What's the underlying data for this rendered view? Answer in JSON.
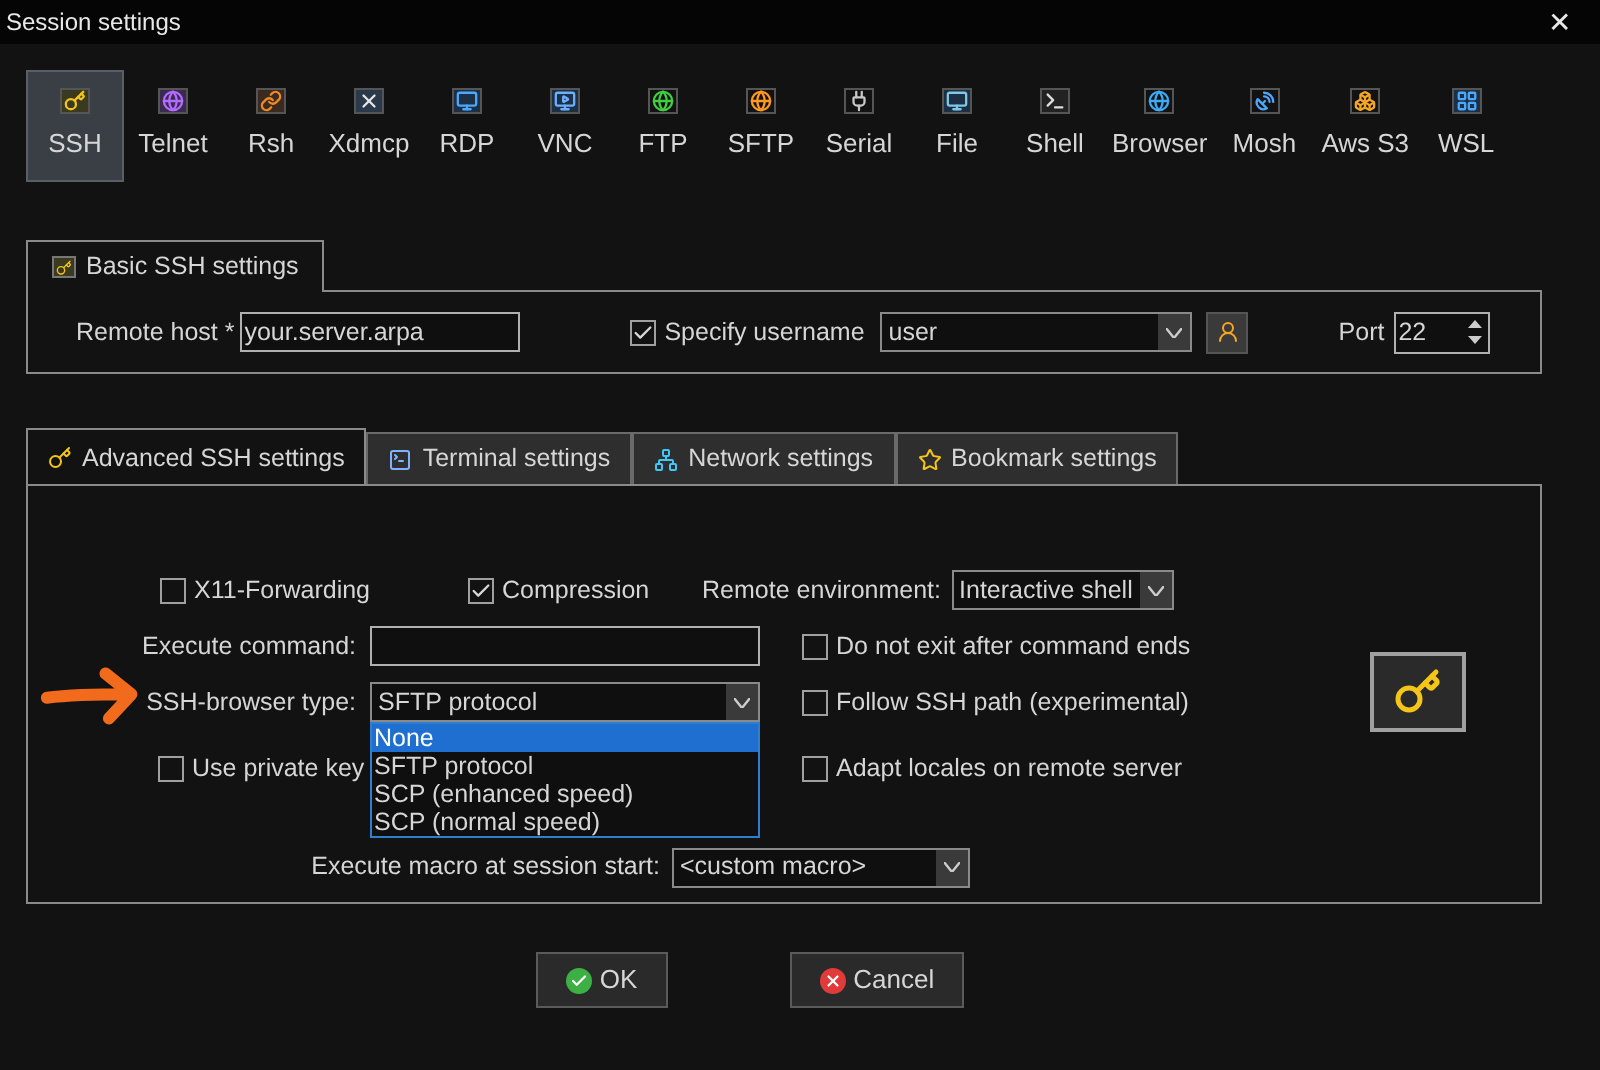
{
  "window": {
    "title": "Session settings",
    "close": "✕"
  },
  "session_types": [
    {
      "label": "SSH",
      "selected": true
    },
    {
      "label": "Telnet",
      "selected": false
    },
    {
      "label": "Rsh",
      "selected": false
    },
    {
      "label": "Xdmcp",
      "selected": false
    },
    {
      "label": "RDP",
      "selected": false
    },
    {
      "label": "VNC",
      "selected": false
    },
    {
      "label": "FTP",
      "selected": false
    },
    {
      "label": "SFTP",
      "selected": false
    },
    {
      "label": "Serial",
      "selected": false
    },
    {
      "label": "File",
      "selected": false
    },
    {
      "label": "Shell",
      "selected": false
    },
    {
      "label": "Browser",
      "selected": false
    },
    {
      "label": "Mosh",
      "selected": false
    },
    {
      "label": "Aws S3",
      "selected": false
    },
    {
      "label": "WSL",
      "selected": false
    }
  ],
  "basic": {
    "tab": "Basic SSH settings",
    "remote_host_label": "Remote host *",
    "remote_host": "your.server.arpa",
    "specify_username": {
      "label": "Specify username",
      "checked": true
    },
    "username": "user",
    "port_label": "Port",
    "port": "22"
  },
  "advanced_tabs": [
    {
      "label": "Advanced SSH settings",
      "selected": true
    },
    {
      "label": "Terminal settings",
      "selected": false
    },
    {
      "label": "Network settings",
      "selected": false
    },
    {
      "label": "Bookmark settings",
      "selected": false
    }
  ],
  "advanced": {
    "x11_forwarding": {
      "label": "X11-Forwarding",
      "checked": false
    },
    "compression": {
      "label": "Compression",
      "checked": true
    },
    "remote_environment_label": "Remote environment:",
    "remote_environment": "Interactive shell",
    "execute_command_label": "Execute command:",
    "do_not_exit": {
      "label": "Do not exit after command ends",
      "checked": false
    },
    "ssh_browser_label": "SSH-browser type:",
    "ssh_browser": "SFTP protocol",
    "ssh_browser_expanded": true,
    "ssh_browser_options": [
      {
        "label": "None",
        "selected": true
      },
      {
        "label": "SFTP protocol",
        "selected": false
      },
      {
        "label": "SCP (enhanced speed)",
        "selected": false
      },
      {
        "label": "SCP (normal speed)",
        "selected": false
      }
    ],
    "follow_ssh_path": {
      "label": "Follow SSH path (experimental)",
      "checked": false
    },
    "use_private_key": {
      "label": "Use private key",
      "checked": false
    },
    "adapt_locales": {
      "label": "Adapt locales on remote server",
      "checked": false
    },
    "macro_label": "Execute macro at session start:",
    "macro": "<custom macro>"
  },
  "buttons": [
    {
      "label": "OK",
      "kind": "ok"
    },
    {
      "label": "Cancel",
      "kind": "cancel"
    }
  ]
}
